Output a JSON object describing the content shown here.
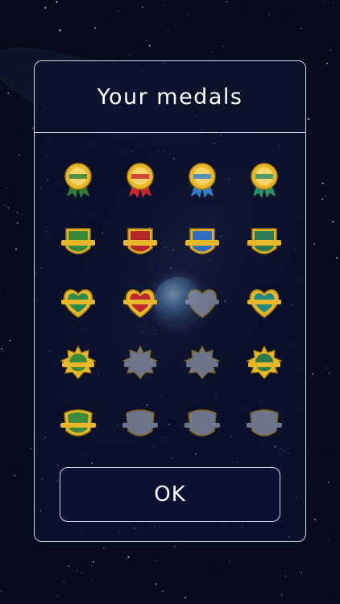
{
  "dialog": {
    "title": "Your medals",
    "ok_label": "OK"
  },
  "colors": {
    "frame": "#cfd6ea",
    "gold": "#e8b82a",
    "locked": "#8f96aa"
  },
  "medals": [
    {
      "shape": "rosette",
      "ribbon": "#2f7a3a",
      "state": "earned"
    },
    {
      "shape": "rosette",
      "ribbon": "#c9242b",
      "state": "earned"
    },
    {
      "shape": "rosette",
      "ribbon": "#2f7fc4",
      "state": "earned"
    },
    {
      "shape": "rosette",
      "ribbon": "#2a8e6a",
      "state": "earned"
    },
    {
      "shape": "shield",
      "ribbon": "#3b8a3a",
      "state": "earned"
    },
    {
      "shape": "shield",
      "ribbon": "#b3262a",
      "state": "earned"
    },
    {
      "shape": "shield",
      "ribbon": "#2f6fc0",
      "state": "earned"
    },
    {
      "shape": "shield",
      "ribbon": "#2a7a52",
      "state": "earned"
    },
    {
      "shape": "heart",
      "ribbon": "#2b8a4a",
      "state": "earned"
    },
    {
      "shape": "heart",
      "ribbon": "#c0272c",
      "state": "earned"
    },
    {
      "shape": "heart",
      "ribbon": "#8f96aa",
      "state": "locked"
    },
    {
      "shape": "heart",
      "ribbon": "#1f8a84",
      "state": "earned"
    },
    {
      "shape": "star",
      "ribbon": "#3a8a3a",
      "state": "earned"
    },
    {
      "shape": "star",
      "ribbon": "#8f96aa",
      "state": "locked"
    },
    {
      "shape": "star",
      "ribbon": "#8f96aa",
      "state": "locked"
    },
    {
      "shape": "star",
      "ribbon": "#2a7a4a",
      "state": "earned"
    },
    {
      "shape": "crest",
      "ribbon": "#3c8a3a",
      "state": "earned"
    },
    {
      "shape": "crest",
      "ribbon": "#8f96aa",
      "state": "locked"
    },
    {
      "shape": "crest",
      "ribbon": "#8f96aa",
      "state": "locked"
    },
    {
      "shape": "crest",
      "ribbon": "#8f96aa",
      "state": "locked"
    }
  ]
}
